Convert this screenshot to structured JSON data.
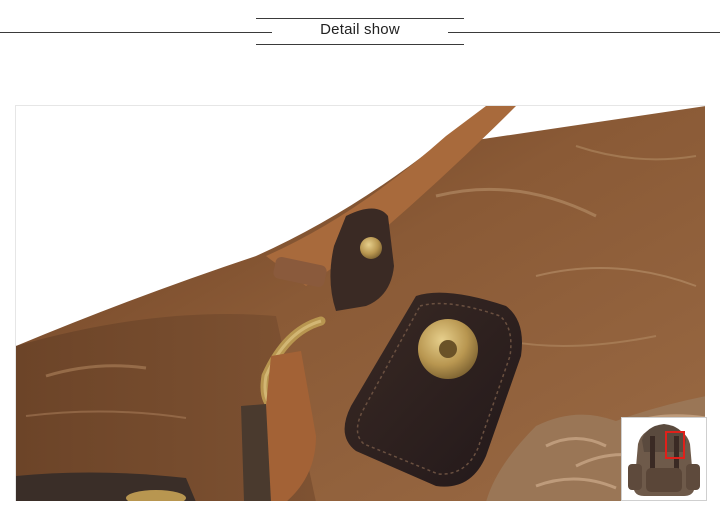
{
  "header": {
    "title": "Detail show"
  },
  "photo": {
    "subject": "leather-strap-and-snap-button-closeup",
    "colors": {
      "canvas": "#8a5a36",
      "canvas_dark": "#5a3420",
      "leather_light": "#a86a3c",
      "leather_dark": "#2e2220",
      "brass": "#b89650"
    }
  },
  "thumbnail": {
    "subject": "backpack-preview",
    "highlight_color": "#e0201a"
  }
}
